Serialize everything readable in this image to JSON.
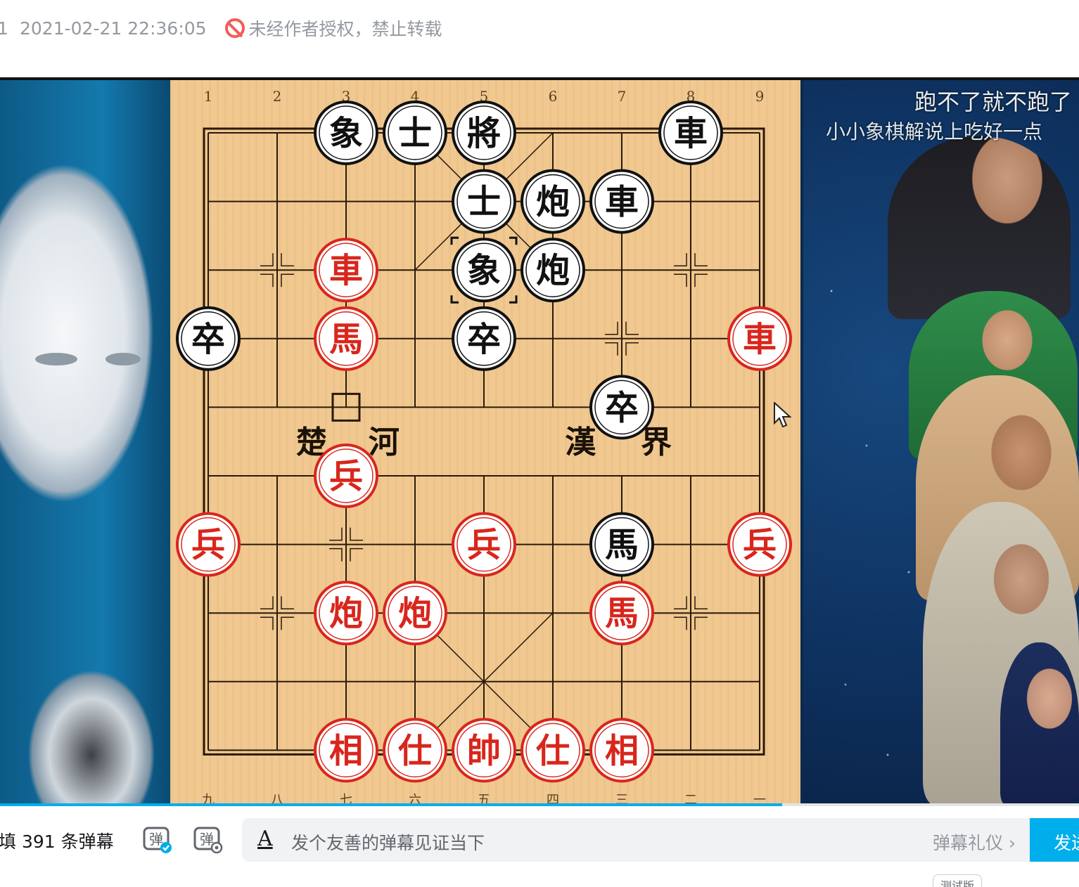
{
  "meta": {
    "view_count_fragment": "1",
    "datetime": "2021-02-21 22:36:05",
    "copyright_notice": "未经作者授权，禁止转载"
  },
  "video": {
    "caption_top": "跑不了就不跑了",
    "caption_channel": "小小象棋解说上吃好一点",
    "board": {
      "top_file_numbers": [
        "1",
        "2",
        "3",
        "4",
        "5",
        "6",
        "7",
        "8",
        "9"
      ],
      "bottom_file_numbers": [
        "九",
        "八",
        "七",
        "六",
        "五",
        "四",
        "三",
        "二",
        "一"
      ],
      "river_left": [
        "楚",
        "河"
      ],
      "river_right": [
        "漢",
        "界"
      ],
      "pieces": [
        {
          "side": "black",
          "char": "象",
          "file": 2,
          "rank": 0
        },
        {
          "side": "black",
          "char": "士",
          "file": 3,
          "rank": 0
        },
        {
          "side": "black",
          "char": "將",
          "file": 4,
          "rank": 0
        },
        {
          "side": "black",
          "char": "車",
          "file": 7,
          "rank": 0
        },
        {
          "side": "black",
          "char": "士",
          "file": 4,
          "rank": 1
        },
        {
          "side": "black",
          "char": "炮",
          "file": 5,
          "rank": 1
        },
        {
          "side": "black",
          "char": "車",
          "file": 6,
          "rank": 1
        },
        {
          "side": "red",
          "char": "車",
          "file": 2,
          "rank": 2
        },
        {
          "side": "black",
          "char": "象",
          "file": 4,
          "rank": 2,
          "selected": true
        },
        {
          "side": "black",
          "char": "炮",
          "file": 5,
          "rank": 2
        },
        {
          "side": "black",
          "char": "卒",
          "file": 0,
          "rank": 3
        },
        {
          "side": "red",
          "char": "馬",
          "file": 2,
          "rank": 3
        },
        {
          "side": "black",
          "char": "卒",
          "file": 4,
          "rank": 3
        },
        {
          "side": "red",
          "char": "車",
          "file": 8,
          "rank": 3
        },
        {
          "side": "black",
          "char": "卒",
          "file": 6,
          "rank": 4
        },
        {
          "side": "red",
          "char": "兵",
          "file": 2,
          "rank": 5
        },
        {
          "side": "red",
          "char": "兵",
          "file": 0,
          "rank": 6
        },
        {
          "side": "red",
          "char": "兵",
          "file": 4,
          "rank": 6
        },
        {
          "side": "black",
          "char": "馬",
          "file": 6,
          "rank": 6
        },
        {
          "side": "red",
          "char": "兵",
          "file": 8,
          "rank": 6
        },
        {
          "side": "red",
          "char": "炮",
          "file": 2,
          "rank": 7
        },
        {
          "side": "red",
          "char": "炮",
          "file": 3,
          "rank": 7
        },
        {
          "side": "red",
          "char": "馬",
          "file": 6,
          "rank": 7
        },
        {
          "side": "red",
          "char": "相",
          "file": 2,
          "rank": 9
        },
        {
          "side": "red",
          "char": "仕",
          "file": 3,
          "rank": 9
        },
        {
          "side": "red",
          "char": "帥",
          "file": 4,
          "rank": 9
        },
        {
          "side": "red",
          "char": "仕",
          "file": 5,
          "rank": 9
        },
        {
          "side": "red",
          "char": "相",
          "file": 6,
          "rank": 9
        }
      ],
      "last_move_from": {
        "file": 2,
        "rank": 4
      },
      "colors": {
        "red": "#d9261c",
        "black": "#111111",
        "board": "#f0c890",
        "line": "#2a1a0a"
      }
    },
    "progress": 0.725
  },
  "danmaku": {
    "count_text": "填 391 条弹幕",
    "toggle_icon": "danmaku-toggle-icon",
    "settings_icon": "danmaku-settings-icon",
    "input_style_icon": "A",
    "placeholder": "发个友善的弹幕见证当下",
    "etiquette_link": "弹幕礼仪 ›",
    "send_label": "发送"
  },
  "beta_badge": "测试版",
  "colors": {
    "accent": "#00aeec",
    "forbid": "#f25d59"
  }
}
